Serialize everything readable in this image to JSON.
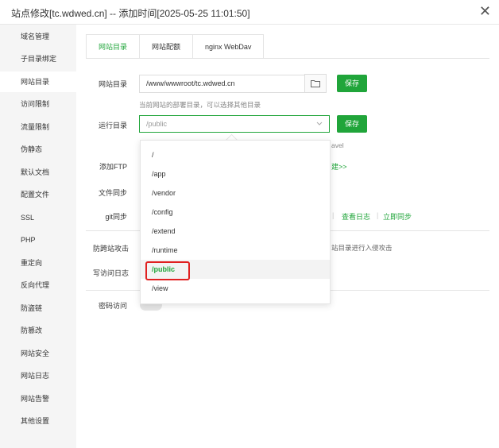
{
  "window": {
    "title": "站点修改[tc.wdwed.cn] -- 添加时间[2025-05-25 11:01:50]",
    "close": "✕"
  },
  "sidebar": {
    "items": [
      {
        "label": "域名管理"
      },
      {
        "label": "子目录绑定"
      },
      {
        "label": "网站目录"
      },
      {
        "label": "访问限制"
      },
      {
        "label": "流量限制"
      },
      {
        "label": "伪静态"
      },
      {
        "label": "默认文档"
      },
      {
        "label": "配置文件"
      },
      {
        "label": "SSL"
      },
      {
        "label": "PHP"
      },
      {
        "label": "重定向"
      },
      {
        "label": "反向代理"
      },
      {
        "label": "防盗链"
      },
      {
        "label": "防篡改"
      },
      {
        "label": "网站安全"
      },
      {
        "label": "网站日志"
      },
      {
        "label": "网站告警"
      },
      {
        "label": "其他设置"
      }
    ],
    "active_index": 2
  },
  "tabs": [
    {
      "label": "网站目录"
    },
    {
      "label": "网站配额"
    },
    {
      "label": "nginx WebDav"
    }
  ],
  "form": {
    "site_dir_label": "网站目录",
    "site_dir_value": "/www/wwwroot/tc.wdwed.cn",
    "save_label": "保存",
    "site_dir_hint": "当前网站的部署目录，可以选择其他目录",
    "run_dir_label": "运行目录",
    "run_dir_value": "/public",
    "run_dir_hint_tail": "avel",
    "ftp_label": "添加FTP",
    "ftp_link_tail": "建>>",
    "file_sync_label": "文件同步",
    "git_sync_label": "git同步",
    "view_log": "查看日志",
    "sync_now": "立即同步",
    "separator": "|",
    "anti_cross_label": "防跨站攻击",
    "anti_cross_hint_tail": "站目录进行入侵攻击",
    "write_log_label": "写访问日志",
    "password_label": "密码访问"
  },
  "dropdown": {
    "options": [
      "/",
      "/app",
      "/vendor",
      "/config",
      "/extend",
      "/runtime",
      "/public",
      "/view"
    ],
    "selected": "/public"
  },
  "colors": {
    "accent": "#20a53a",
    "highlight_box": "#e02020"
  },
  "icons": {
    "folder": "folder-icon",
    "chevron": "chevron-down-icon",
    "close": "close-icon"
  }
}
